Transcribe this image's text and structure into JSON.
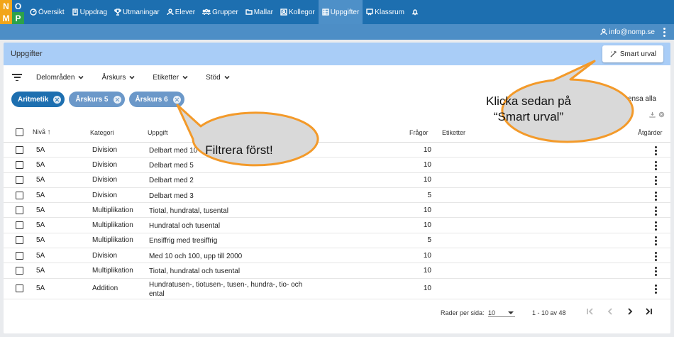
{
  "logo": [
    "N",
    "O",
    "M",
    "P"
  ],
  "nav": [
    {
      "label": "Översikt",
      "icon": "dashboard-icon"
    },
    {
      "label": "Uppdrag",
      "icon": "book-icon"
    },
    {
      "label": "Utmaningar",
      "icon": "trophy-icon"
    },
    {
      "label": "Elever",
      "icon": "user-icon"
    },
    {
      "label": "Grupper",
      "icon": "group-icon"
    },
    {
      "label": "Mallar",
      "icon": "folder-icon"
    },
    {
      "label": "Kollegor",
      "icon": "contacts-icon"
    },
    {
      "label": "Uppgifter",
      "icon": "grid-icon",
      "active": true
    },
    {
      "label": "Klassrum",
      "icon": "classroom-icon"
    },
    {
      "label": "",
      "icon": "bell-icon"
    }
  ],
  "user": {
    "email": "info@nomp.se"
  },
  "panel": {
    "title": "Uppgifter",
    "smart_button": "Smart urval"
  },
  "filters": [
    "Delområden",
    "Årskurs",
    "Etiketter",
    "Stöd"
  ],
  "chips": [
    "Aritmetik",
    "Årskurs 5",
    "Årskurs 6"
  ],
  "clear_all": "Rensa alla",
  "table": {
    "headers": {
      "level": "Nivå",
      "category": "Kategori",
      "task": "Uppgift",
      "questions": "Frågor",
      "tags": "Etiketter",
      "actions": "Åtgärder"
    },
    "rows": [
      {
        "level": "5A",
        "category": "Division",
        "task": "Delbart med 10",
        "questions": "10"
      },
      {
        "level": "5A",
        "category": "Division",
        "task": "Delbart med 5",
        "questions": "10"
      },
      {
        "level": "5A",
        "category": "Division",
        "task": "Delbart med 2",
        "questions": "10"
      },
      {
        "level": "5A",
        "category": "Division",
        "task": "Delbart med 3",
        "questions": "5"
      },
      {
        "level": "5A",
        "category": "Multiplikation",
        "task": "Tiotal, hundratal, tusental",
        "questions": "10"
      },
      {
        "level": "5A",
        "category": "Multiplikation",
        "task": "Hundratal och tusental",
        "questions": "10"
      },
      {
        "level": "5A",
        "category": "Multiplikation",
        "task": "Ensiffrig med tresiffrig",
        "questions": "5"
      },
      {
        "level": "5A",
        "category": "Division",
        "task": "Med 10 och 100, upp till 2000",
        "questions": "10"
      },
      {
        "level": "5A",
        "category": "Multiplikation",
        "task": "Tiotal, hundratal och tusental",
        "questions": "10"
      },
      {
        "level": "5A",
        "category": "Addition",
        "task": "Hundratusen-, tiotusen-, tusen-, hundra-, tio- och ental",
        "questions": "10"
      }
    ]
  },
  "pagination": {
    "rows_per_page_label": "Rader per sida:",
    "rows_per_page": "10",
    "range": "1 - 10 av 48"
  },
  "callouts": {
    "filter": "Filtrera först!",
    "smart_line1": "Klicka sedan på",
    "smart_line2": "“Smart urval”"
  },
  "colors": {
    "nav": "#1d6fb0",
    "subbar": "#4d8ec6",
    "panel_head": "#a9cdf7",
    "callout_border": "#f39a2a",
    "callout_fill": "#d9d9d9"
  }
}
